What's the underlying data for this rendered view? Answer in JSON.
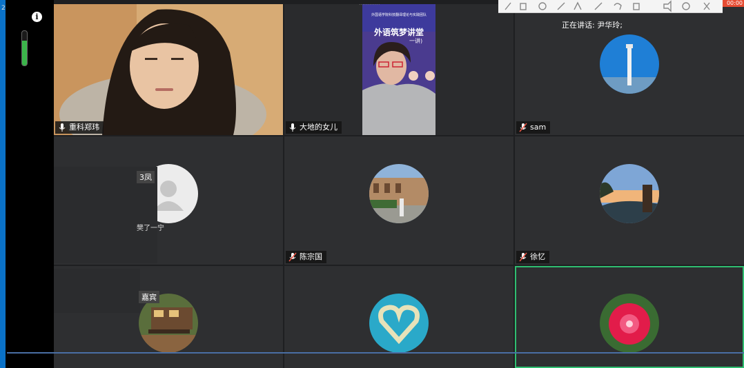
{
  "left_panel": {
    "level_marker": "2",
    "info_label": "i",
    "mic_level": 0.72
  },
  "top_toolbar": {
    "hint": "............",
    "timer": "00:00"
  },
  "meeting": {
    "speaking_text": "正在讲话: 尹华玲;",
    "colors": {
      "accent": "#2fbf71",
      "tile_bg": "#2e2f31"
    },
    "tiles": [
      {
        "name": "重科郑玮",
        "kind": "video-woman"
      },
      {
        "name": "大地的女儿",
        "kind": "video-poster"
      },
      {
        "name": "sam",
        "kind": "avatar-tower",
        "muted": true
      },
      {
        "name": "",
        "kind": "avatar-default"
      },
      {
        "name": "陈宗国",
        "kind": "avatar-campus",
        "muted": true
      },
      {
        "name": "徐忆",
        "kind": "avatar-sunset",
        "muted": true
      },
      {
        "name": "",
        "kind": "avatar-house"
      },
      {
        "name": "",
        "kind": "avatar-heart"
      },
      {
        "name": "",
        "kind": "avatar-flower"
      }
    ],
    "poster": {
      "org": "外国语学院科技翻译理论与实践团队",
      "title": "外语筑梦讲堂",
      "sub": "一讲)"
    },
    "partial_labels": {
      "row2_a": "3凤",
      "row2_b": "樊了一宁",
      "row3_a": "嘉宾"
    }
  }
}
